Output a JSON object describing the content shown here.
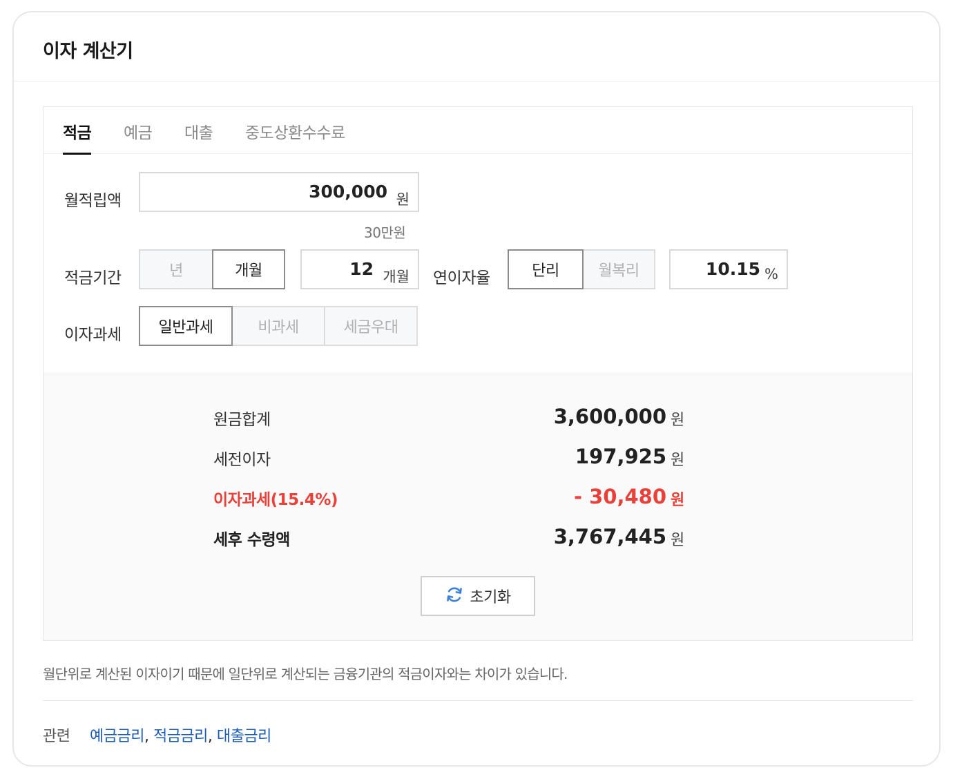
{
  "header": {
    "title": "이자 계산기"
  },
  "tabs": [
    {
      "label": "적금",
      "active": true
    },
    {
      "label": "예금",
      "active": false
    },
    {
      "label": "대출",
      "active": false
    },
    {
      "label": "중도상환수수료",
      "active": false
    }
  ],
  "monthly": {
    "label": "월적립액",
    "value": "300,000",
    "unit": "원",
    "hint": "30만원"
  },
  "period": {
    "label": "적금기간",
    "options": [
      {
        "label": "년",
        "selected": false
      },
      {
        "label": "개월",
        "selected": true
      }
    ],
    "value": "12",
    "unit": "개월"
  },
  "rate": {
    "label": "연이자율",
    "options": [
      {
        "label": "단리",
        "selected": true
      },
      {
        "label": "월복리",
        "selected": false
      }
    ],
    "value": "10.15",
    "unit": "%"
  },
  "tax": {
    "label": "이자과세",
    "options": [
      {
        "label": "일반과세",
        "selected": true
      },
      {
        "label": "비과세",
        "selected": false
      },
      {
        "label": "세금우대",
        "selected": false
      }
    ]
  },
  "results": [
    {
      "label": "원금합계",
      "value": "3,600,000",
      "unit": "원"
    },
    {
      "label": "세전이자",
      "value": "197,925",
      "unit": "원"
    },
    {
      "label": "이자과세(15.4%)",
      "value": "- 30,480",
      "unit": "원"
    },
    {
      "label": "세후 수령액",
      "value": "3,767,445",
      "unit": "원"
    }
  ],
  "reset": {
    "label": "초기화"
  },
  "notice": "월단위로 계산된 이자이기 때문에 일단위로 계산되는 금융기관의 적금이자와는 차이가 있습니다.",
  "related": {
    "label": "관련",
    "links": [
      "예금금리",
      "적금금리",
      "대출금리"
    ],
    "separator": ","
  },
  "colors": {
    "accent_red": "#e8413a",
    "link_blue": "#1d5cb4",
    "reset_icon_blue": "#3d7fd6"
  },
  "icons": {
    "reset": "refresh-icon"
  }
}
